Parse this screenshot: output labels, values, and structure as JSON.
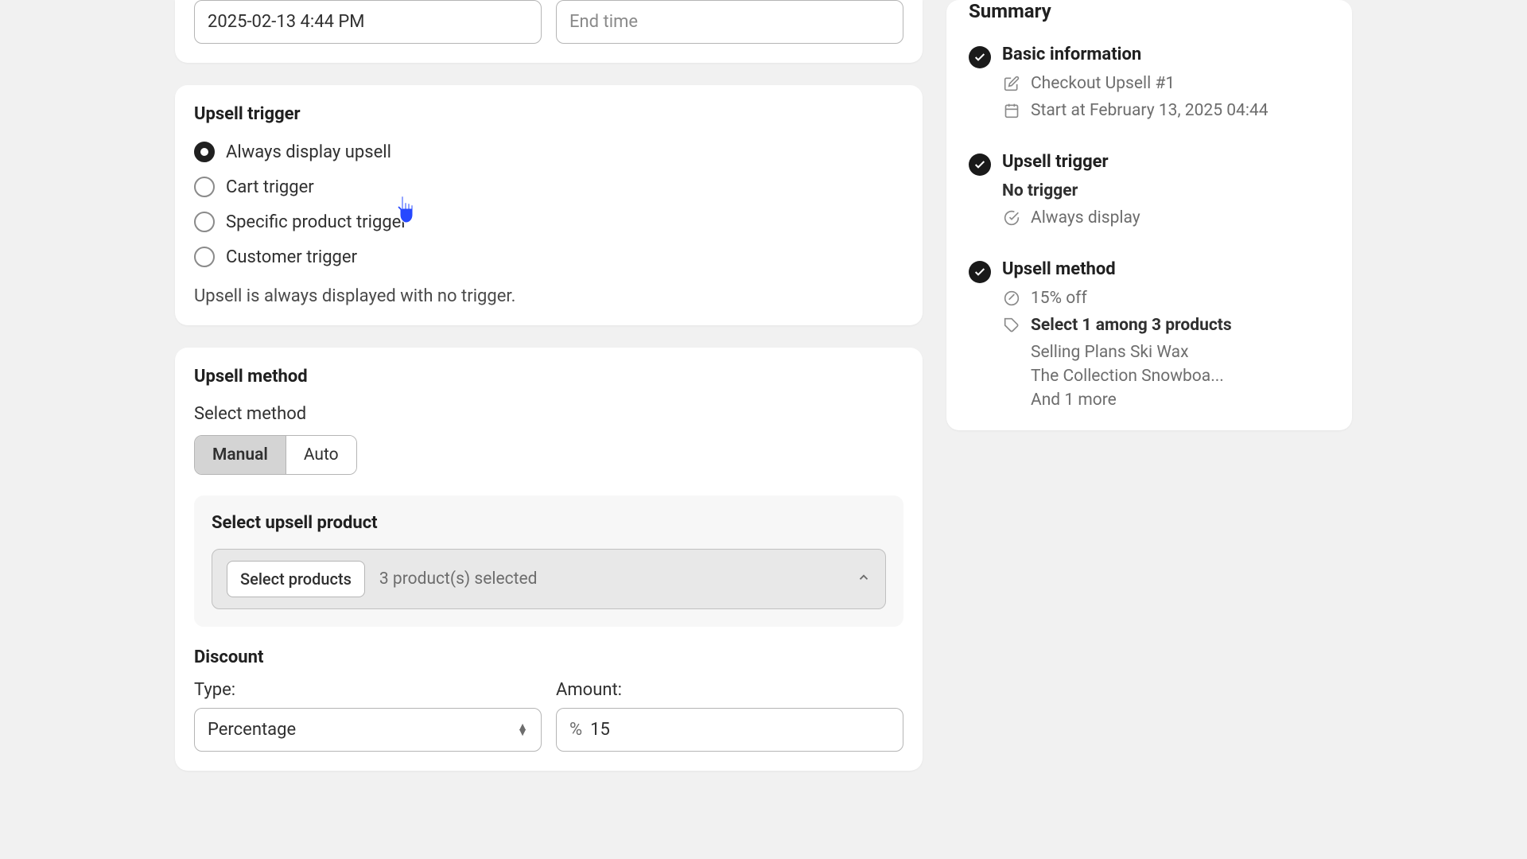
{
  "dates": {
    "start_value": "2025-02-13 4:44 PM",
    "end_placeholder": "End time"
  },
  "trigger": {
    "title": "Upsell trigger",
    "options": {
      "always": "Always display upsell",
      "cart": "Cart trigger",
      "specific": "Specific product trigger",
      "customer": "Customer trigger"
    },
    "helper": "Upsell is always displayed with no trigger."
  },
  "method": {
    "title": "Upsell method",
    "select_label": "Select method",
    "manual": "Manual",
    "auto": "Auto",
    "select_product_title": "Select upsell product",
    "select_products_btn": "Select products",
    "selected_count": "3 product(s) selected",
    "discount_title": "Discount",
    "type_label": "Type:",
    "type_value": "Percentage",
    "amount_label": "Amount:",
    "amount_prefix": "%",
    "amount_value": "15"
  },
  "summary": {
    "title": "Summary",
    "basic": {
      "heading": "Basic information",
      "name": "Checkout Upsell #1",
      "start": "Start at February 13, 2025 04:44"
    },
    "trigger": {
      "heading": "Upsell trigger",
      "subheading": "No trigger",
      "detail": "Always display"
    },
    "method": {
      "heading": "Upsell method",
      "discount": "15% off",
      "select_line": "Select 1 among 3 products",
      "p1": "Selling Plans Ski Wax",
      "p2": "The Collection Snowboa...",
      "more": "And 1 more"
    }
  }
}
